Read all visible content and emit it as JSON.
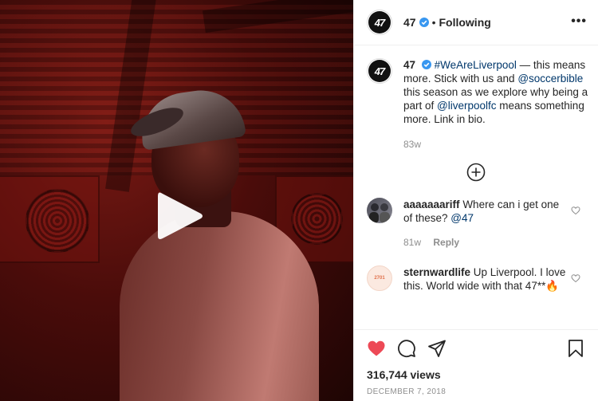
{
  "header": {
    "username": "47",
    "separator": "•",
    "follow_status": "Following",
    "more_label": "•••",
    "avatar_text": "47"
  },
  "caption": {
    "username": "47",
    "segments": [
      {
        "type": "link",
        "text": "#WeAreLiverpool"
      },
      {
        "type": "text",
        "text": " — this means more. Stick with us and "
      },
      {
        "type": "link",
        "text": "@soccerbible"
      },
      {
        "type": "text",
        "text": " this season as we explore why being a part of "
      },
      {
        "type": "link",
        "text": "@liverpoolfc"
      },
      {
        "type": "text",
        "text": " means something more. Link in bio."
      }
    ],
    "age": "83w"
  },
  "comments": [
    {
      "username": "aaaaaaariff",
      "text": " Where can i get one of these? ",
      "mention": "@47",
      "age": "81w",
      "reply_label": "Reply"
    },
    {
      "username": "sternwardlife",
      "text": " Up Liverpool. I love this. World wide with that 47**🔥",
      "avatar_text": "2701"
    }
  ],
  "actions": {
    "views": "316,744 views",
    "date": "DECEMBER 7, 2018"
  },
  "colors": {
    "like_red": "#ed4956",
    "verified_blue": "#3897f0",
    "link_blue": "#00376b"
  },
  "icons": [
    "play-icon",
    "verified-icon",
    "more-icon",
    "load-more-plus-icon",
    "heart-icon",
    "comment-icon",
    "share-icon",
    "bookmark-icon"
  ]
}
